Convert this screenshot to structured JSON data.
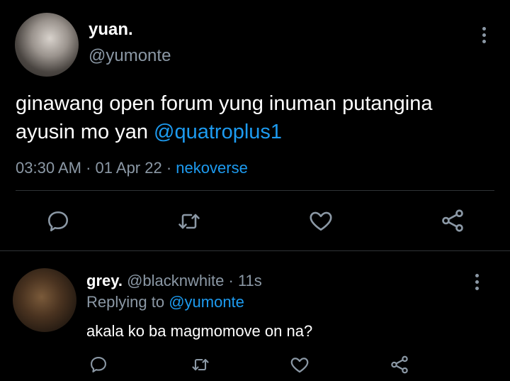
{
  "main_tweet": {
    "display_name": "yuan.",
    "handle": "@yumonte",
    "text_line1": "ginawang open forum yung inuman putangina",
    "text_line2_prefix": "ayusin mo yan ",
    "mention": "@quatroplus1",
    "time": "03:30 AM",
    "sep1": "·",
    "date": "01 Apr 22",
    "sep2": "·",
    "client": "nekoverse"
  },
  "reply": {
    "display_name": "grey.",
    "handle": "@blacknwhite",
    "sep": "·",
    "time_ago": "11s",
    "replying_prefix": "Replying to ",
    "replying_to": "@yumonte",
    "text": "akala ko ba magmomove on na?"
  },
  "icons": {
    "reply": "reply-icon",
    "retweet": "retweet-icon",
    "like": "heart-icon",
    "share": "share-icon",
    "more": "more-vertical-icon"
  },
  "colors": {
    "background": "#000000",
    "text": "#e7e9ea",
    "muted": "#8b98a5",
    "accent": "#1d9bf0"
  }
}
